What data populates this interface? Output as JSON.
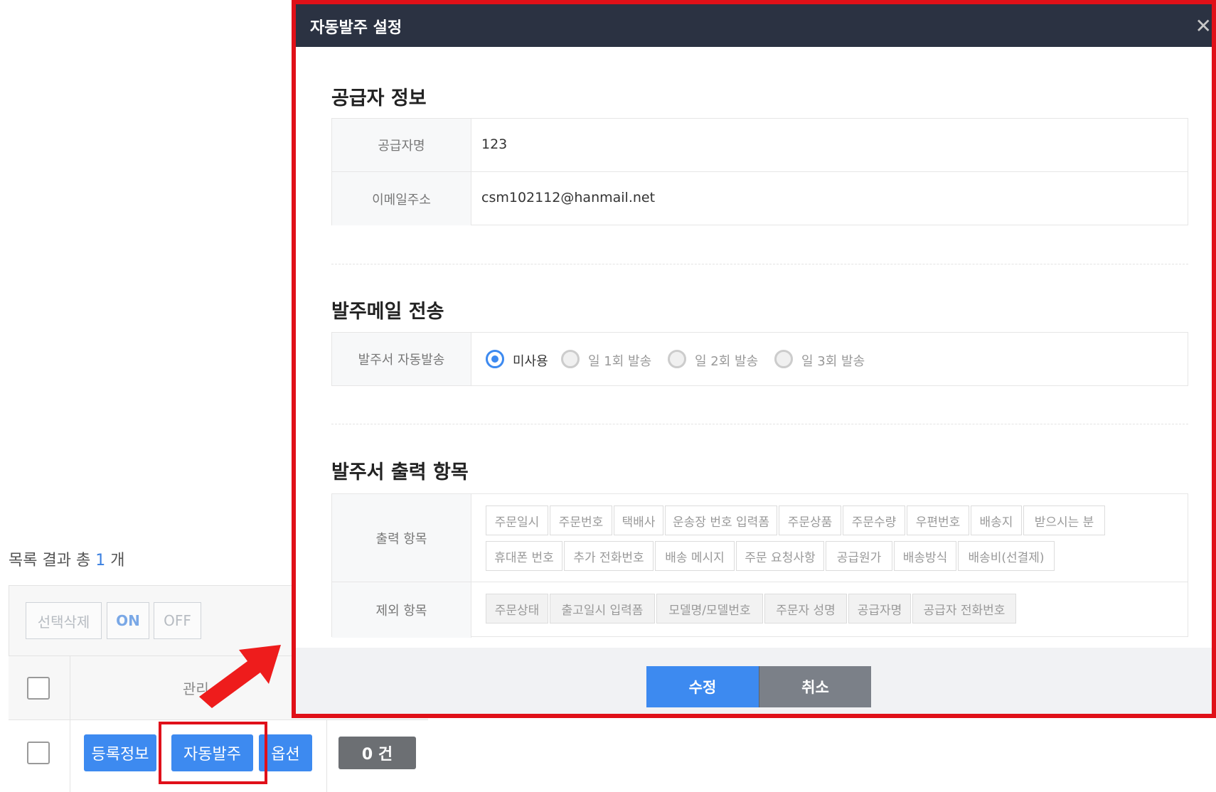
{
  "list": {
    "title_prefix": "목록 결과 총",
    "count": "1",
    "title_suffix": "개",
    "toolbar": {
      "delete_label": "선택삭제",
      "on_label": "ON",
      "off_label": "OFF"
    },
    "header_manage": "관리",
    "row": {
      "btn_register": "등록정보",
      "btn_auto_order": "자동발주",
      "btn_option": "옵션",
      "order_count": "0 건"
    }
  },
  "modal": {
    "title": "자동발주 설정",
    "close": "✕",
    "supplier_section": {
      "title": "공급자 정보",
      "name_label": "공급자명",
      "name_value": "123",
      "email_label": "이메일주소",
      "email_value": "csm102112@hanmail.net"
    },
    "mail_section": {
      "title": "발주메일 전송",
      "auto_label": "발주서 자동발송",
      "options": [
        "미사용",
        "일 1회 발송",
        "일 2회 발송",
        "일 3회 발송"
      ],
      "selected": "미사용"
    },
    "output_section": {
      "title": "발주서 출력 항목",
      "output_label": "출력 항목",
      "output_items": [
        "주문일시",
        "주문번호",
        "택배사",
        "운송장 번호 입력폼",
        "주문상품",
        "주문수량",
        "우편번호",
        "배송지",
        "받으시는 분",
        "휴대폰 번호",
        "추가 전화번호",
        "배송 메시지",
        "주문 요청사항",
        "공급원가",
        "배송방식",
        "배송비(선결제)"
      ],
      "exclude_label": "제외 항목",
      "exclude_items": [
        "주문상태",
        "출고일시 입력폼",
        "모델명/모델번호",
        "주문자 성명",
        "공급자명",
        "공급자 전화번호"
      ]
    },
    "footer": {
      "save": "수정",
      "cancel": "취소"
    }
  },
  "colors": {
    "accent": "#3d8af0",
    "highlight": "#e01018",
    "header_bg": "#2b3242"
  }
}
